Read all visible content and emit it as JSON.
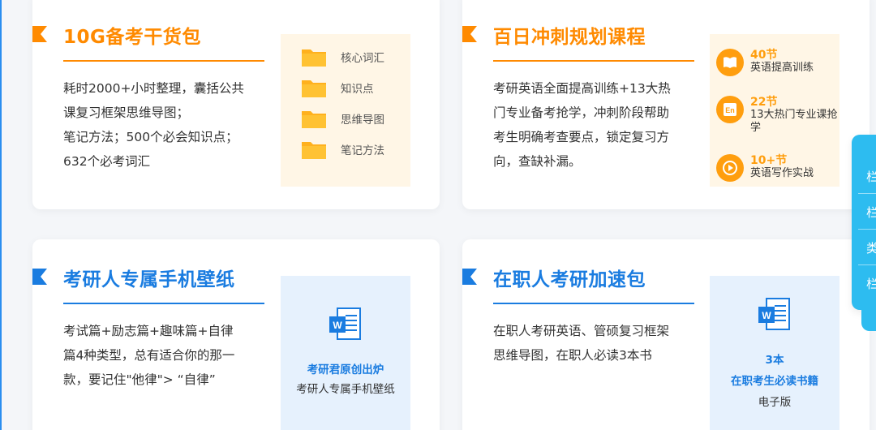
{
  "colors": {
    "orange": "#ff8a00",
    "blue": "#1a7ce0",
    "orange_panel": "#fff6e6",
    "blue_panel": "#e6f1fd",
    "side_float": "#2dbcf0"
  },
  "cards": {
    "c1": {
      "title": "10G备考干货包",
      "desc": [
        "耗时2000+小时整理，囊括公共",
        "课复习框架思维导图；",
        "笔记方法；500个必会知识点；",
        "632个必考词汇"
      ],
      "items": [
        {
          "label": "核心词汇",
          "icon": "folder-icon"
        },
        {
          "label": "知识点",
          "icon": "folder-icon"
        },
        {
          "label": "思维导图",
          "icon": "folder-icon"
        },
        {
          "label": "笔记方法",
          "icon": "folder-icon"
        }
      ]
    },
    "c2": {
      "title": "百日冲刺规划课程",
      "desc": [
        "考研英语全面提高训练+13大热",
        "门专业备考抢学，冲刺阶段帮助",
        "考生明确考查要点，锁定复习方",
        "向，查缺补漏。"
      ],
      "badges": [
        {
          "count": "40节",
          "text": "英语提高训练",
          "icon": "book-icon"
        },
        {
          "count": "22节",
          "text": "13大热门专业课抢学",
          "icon": "en-icon"
        },
        {
          "count": "10+节",
          "text": "英语写作实战",
          "icon": "play-icon"
        }
      ]
    },
    "c3": {
      "title": "考研人专属手机壁纸",
      "desc": [
        "考试篇+励志篇+趣味篇+自律",
        "篇4种类型，总有适合你的那一",
        "款，要记住\"他律\"> “自律”"
      ],
      "panel": {
        "icon": "word-document-icon",
        "line1": "考研君原创出炉",
        "line2": "考研人专属手机壁纸"
      }
    },
    "c4": {
      "title": "在职人考研加速包",
      "desc": [
        "在职人考研英语、管硕复习框架",
        "思维导图，在职人必读3本书"
      ],
      "panel": {
        "icon": "word-document-icon",
        "line1": "3本",
        "line2": "在职考生必读书籍",
        "line3": "电子版"
      }
    }
  },
  "side_float": {
    "items": [
      "栏",
      "栏",
      "类",
      "栏"
    ]
  }
}
